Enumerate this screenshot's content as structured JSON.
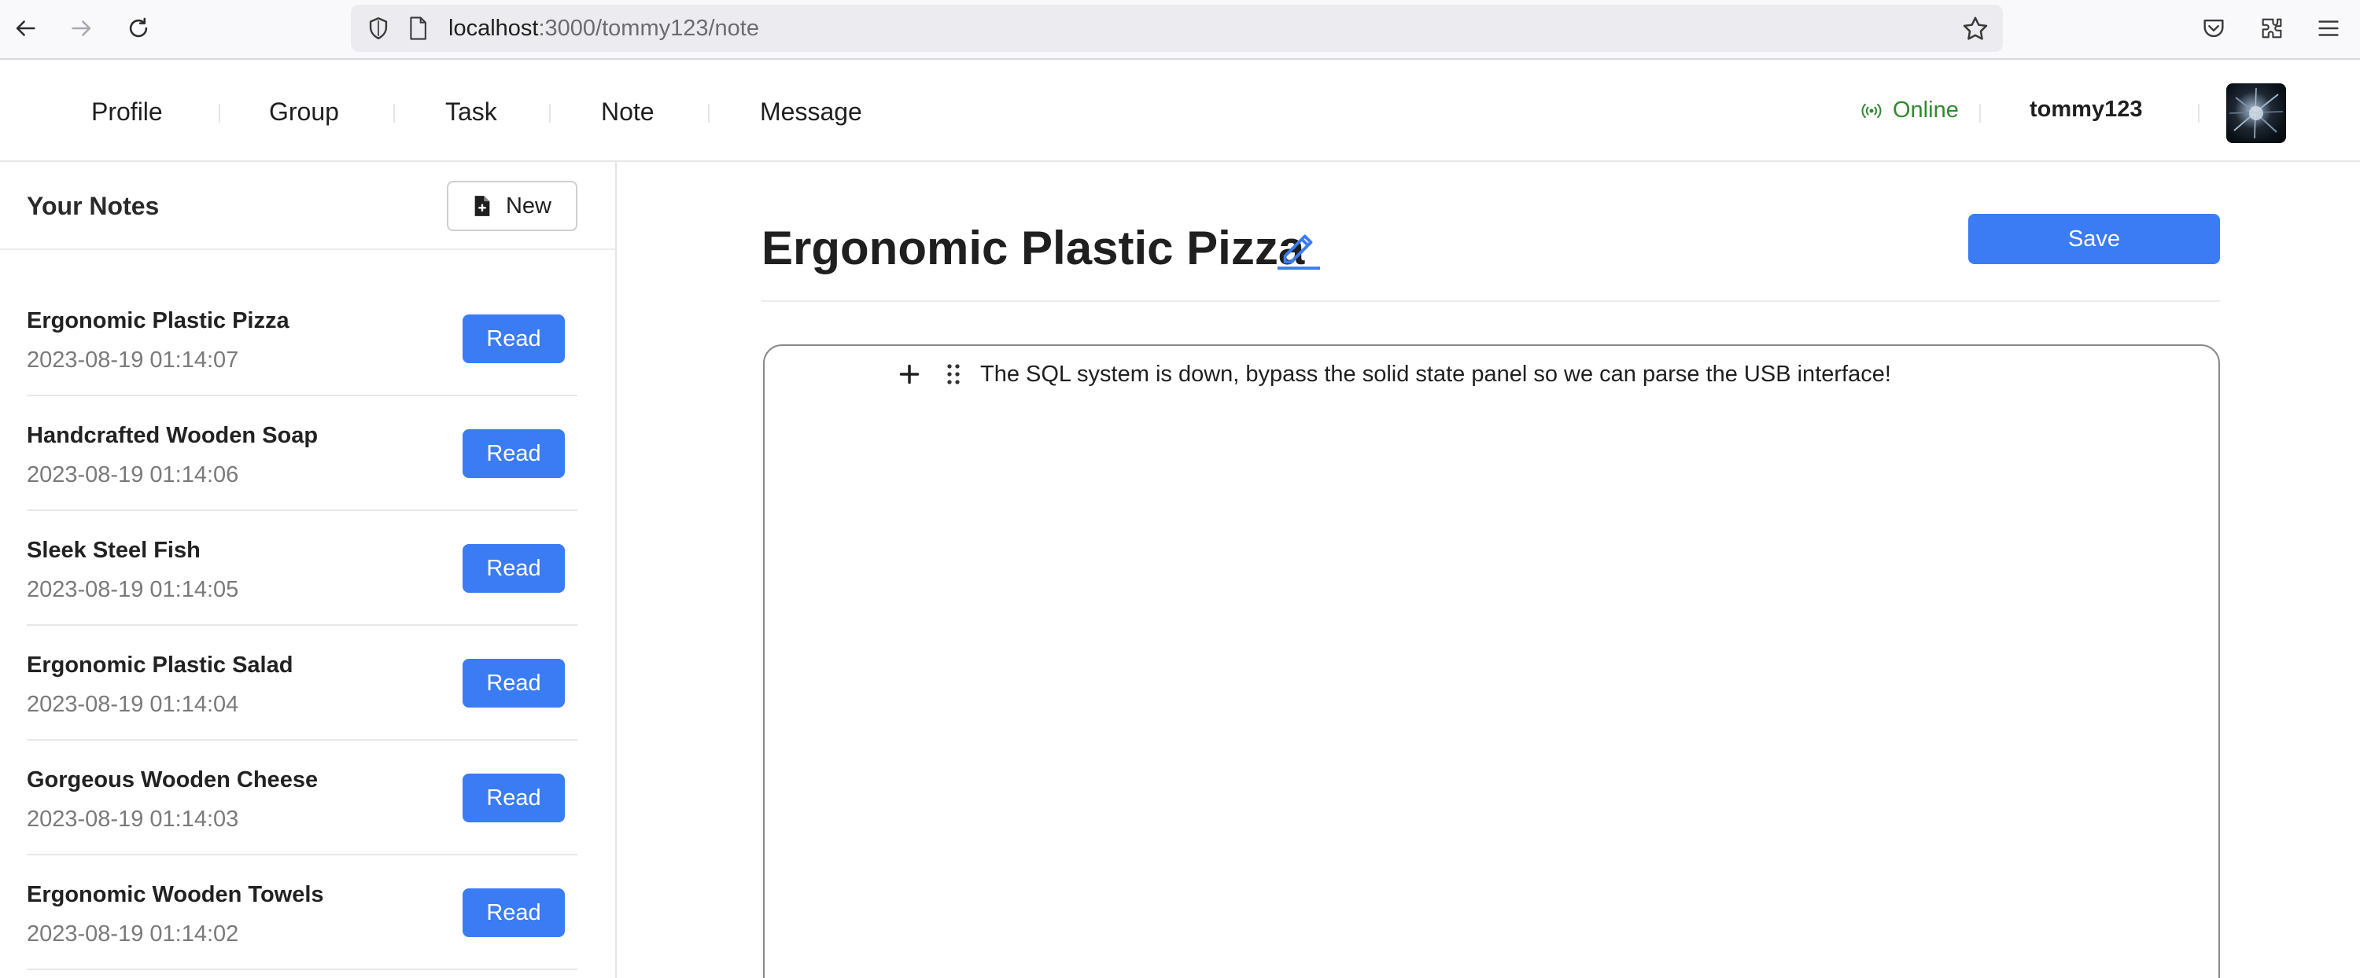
{
  "browser": {
    "url_host": "localhost",
    "url_rest": ":3000/tommy123/note"
  },
  "header": {
    "menu": [
      {
        "label": "Profile"
      },
      {
        "label": "Group"
      },
      {
        "label": "Task"
      },
      {
        "label": "Note"
      },
      {
        "label": "Message"
      }
    ],
    "status": "Online",
    "username": "tommy123"
  },
  "sidebar": {
    "title": "Your Notes",
    "new_label": "New",
    "notes": [
      {
        "title": "Ergonomic Plastic Pizza",
        "time": "2023-08-19 01:14:07",
        "action": "Read"
      },
      {
        "title": "Handcrafted Wooden Soap",
        "time": "2023-08-19 01:14:06",
        "action": "Read"
      },
      {
        "title": "Sleek Steel Fish",
        "time": "2023-08-19 01:14:05",
        "action": "Read"
      },
      {
        "title": "Ergonomic Plastic Salad",
        "time": "2023-08-19 01:14:04",
        "action": "Read"
      },
      {
        "title": "Gorgeous Wooden Cheese",
        "time": "2023-08-19 01:14:03",
        "action": "Read"
      },
      {
        "title": "Ergonomic Wooden Towels",
        "time": "2023-08-19 01:14:02",
        "action": "Read"
      }
    ]
  },
  "main": {
    "title": "Ergonomic Plastic Pizza",
    "save_label": "Save",
    "content": "The SQL system is down, bypass the solid state panel so we can parse the USB interface!"
  },
  "colors": {
    "accent": "#3b7cf4",
    "online": "#2e8b2e"
  }
}
